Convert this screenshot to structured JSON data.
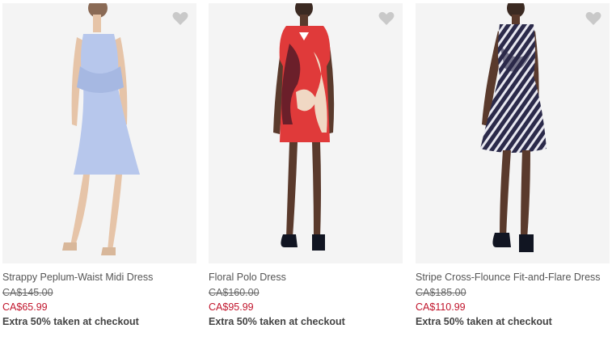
{
  "products": [
    {
      "name": "Strappy Peplum-Waist Midi Dress",
      "original_price": "CA$145.00",
      "sale_price": "CA$65.99",
      "promo": "Extra 50% taken at checkout",
      "favorite_icon": "heart-icon",
      "dress_color": "#b7c7ec"
    },
    {
      "name": "Floral Polo Dress",
      "original_price": "CA$160.00",
      "sale_price": "CA$95.99",
      "promo": "Extra 50% taken at checkout",
      "favorite_icon": "heart-icon",
      "dress_color": "#e03a3a"
    },
    {
      "name": "Stripe Cross-Flounce Fit-and-Flare Dress",
      "original_price": "CA$185.00",
      "sale_price": "CA$110.99",
      "promo": "Extra 50% taken at checkout",
      "favorite_icon": "heart-icon",
      "dress_color": "#2b2a4a"
    }
  ],
  "colors": {
    "sale_price": "#c0142b",
    "favorite_icon": "#c9c9c9",
    "photo_background": "#f3f3f3"
  }
}
